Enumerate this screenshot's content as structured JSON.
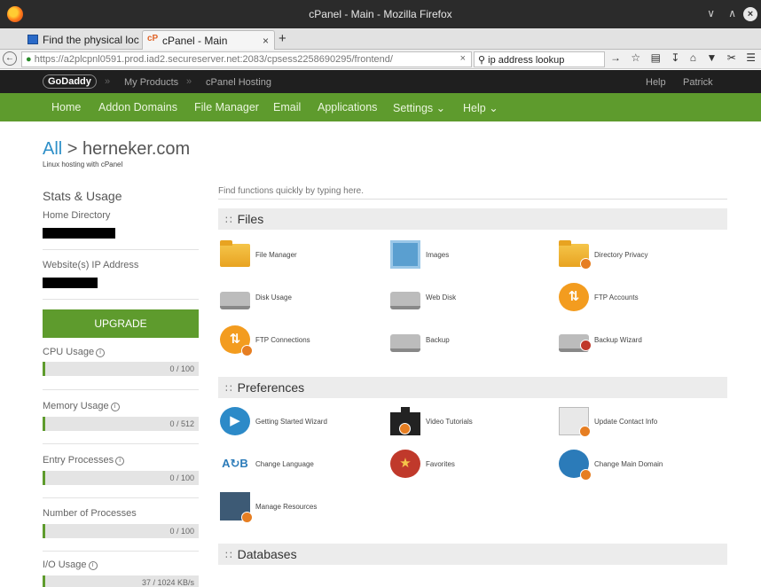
{
  "window": {
    "title": "cPanel - Main - Mozilla Firefox"
  },
  "tabs": [
    {
      "label": "Find the physical loc »"
    },
    {
      "label": "cPanel - Main"
    }
  ],
  "nav": {
    "url": "https://a2plcpnl0591.prod.iad2.secureserver.net:2083/cpsess2258690295/frontend/",
    "search_value": "ip address lookup"
  },
  "godaddy": {
    "logo": "GoDaddy",
    "items": [
      "My Products",
      "cPanel Hosting",
      "Help",
      "Patrick"
    ]
  },
  "cpanel_nav": [
    "Home",
    "Addon Domains",
    "File Manager",
    "Email",
    "Applications",
    "Settings",
    "Help"
  ],
  "breadcrumb": {
    "all": "All",
    "sep": ">",
    "domain": "herneker.com",
    "subtitle": "Linux hosting with cPanel"
  },
  "sidebar": {
    "title": "Stats & Usage",
    "home_directory_label": "Home Directory",
    "ip_label": "Website(s) IP Address",
    "upgrade_label": "UPGRADE",
    "usages": [
      {
        "label": "CPU Usage",
        "value": "0 / 100"
      },
      {
        "label": "Memory Usage",
        "value": "0 / 512"
      },
      {
        "label": "Entry Processes",
        "value": "0 / 100"
      },
      {
        "label": "Number of Processes",
        "value": "0 / 100"
      },
      {
        "label": "I/O Usage",
        "value": "37 / 1024 KB/s"
      }
    ]
  },
  "search": {
    "placeholder": "Find functions quickly by typing here."
  },
  "sections": {
    "files": {
      "title": "Files",
      "tools": [
        "File Manager",
        "Images",
        "Directory Privacy",
        "Disk Usage",
        "Web Disk",
        "FTP Accounts",
        "FTP Connections",
        "Backup",
        "Backup Wizard"
      ]
    },
    "preferences": {
      "title": "Preferences",
      "tools": [
        "Getting Started Wizard",
        "Video Tutorials",
        "Update Contact Info",
        "Change Language",
        "Favorites",
        "Change Main Domain",
        "Manage Resources"
      ]
    },
    "databases": {
      "title": "Databases"
    }
  }
}
